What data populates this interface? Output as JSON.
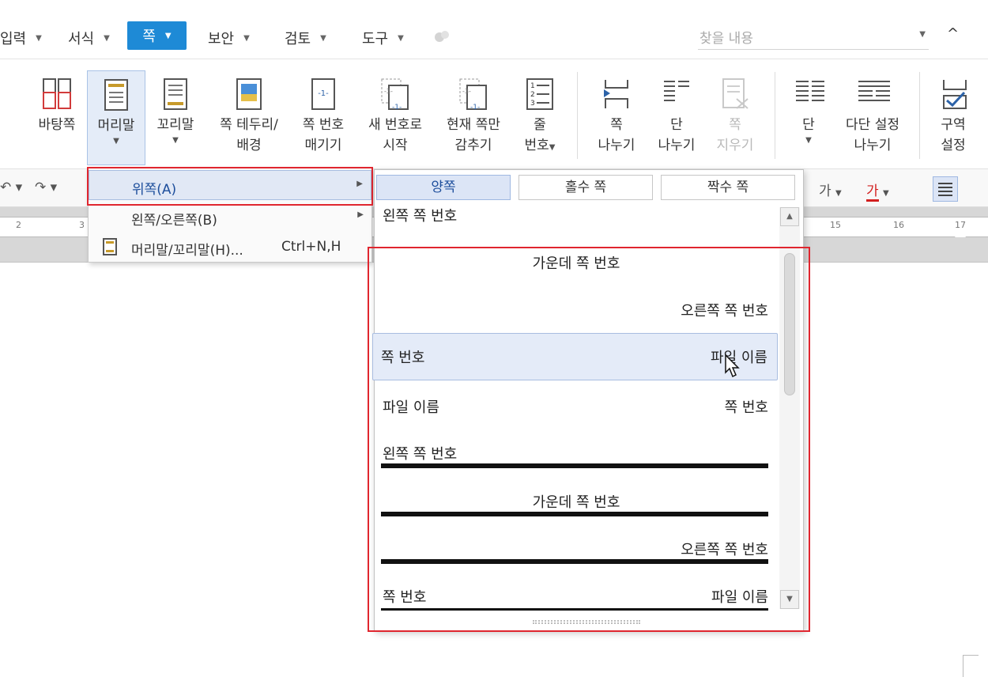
{
  "menubar": {
    "partial_left": "입력",
    "items": [
      {
        "label": "서식"
      },
      {
        "label": "쪽",
        "active": true
      },
      {
        "label": "보안"
      },
      {
        "label": "검토"
      },
      {
        "label": "도구"
      }
    ],
    "search_placeholder": "찾을 내용",
    "collapse_symbol": "^"
  },
  "ribbon": {
    "buttons": [
      {
        "id": "master-page",
        "label": "바탕쪽"
      },
      {
        "id": "header",
        "label": "머리말",
        "active": true,
        "dropdown": true
      },
      {
        "id": "footer",
        "label": "꼬리말",
        "dropdown": true
      },
      {
        "id": "page-border",
        "label1": "쪽 테두리/",
        "label2": "배경"
      },
      {
        "id": "page-number",
        "label1": "쪽 번호",
        "label2": "매기기"
      },
      {
        "id": "new-number",
        "label1": "새 번호로",
        "label2": "시작"
      },
      {
        "id": "hide-current",
        "label1": "현재 쪽만",
        "label2": "감추기"
      },
      {
        "id": "line-number",
        "label1": "줄",
        "label2": "번호"
      },
      {
        "id": "page-break",
        "label1": "쪽",
        "label2": "나누기"
      },
      {
        "id": "column-break",
        "label1": "단",
        "label2": "나누기"
      },
      {
        "id": "page-delete",
        "label1": "쪽",
        "label2": "지우기",
        "disabled": true
      },
      {
        "id": "columns",
        "label": "단",
        "dropdown": true
      },
      {
        "id": "multi-column",
        "label1": "다단 설정",
        "label2": "나누기"
      },
      {
        "id": "section",
        "label1": "구역",
        "label2": "설정"
      }
    ],
    "pagenum_glyph": "-1-",
    "pagenum_glyph_3": "-3-",
    "line_number_glyph": "1\n2\n3"
  },
  "toolbar2": {
    "char_glyph": "가",
    "color_char_glyph": "가"
  },
  "ruler": {
    "numbers": [
      "2",
      "3",
      "15",
      "16",
      "17"
    ]
  },
  "dropdown_menu": {
    "items": [
      {
        "label": "위쪽(A)",
        "submenu": true,
        "highlighted": true
      },
      {
        "label": "왼쪽/오른쪽(B)",
        "submenu": true
      },
      {
        "label": "머리말/꼬리말(H)...",
        "shortcut": "Ctrl+N,H"
      }
    ]
  },
  "gallery": {
    "tabs": [
      {
        "label": "양쪽",
        "selected": true
      },
      {
        "label": "홀수 쪽"
      },
      {
        "label": "짝수 쪽"
      }
    ],
    "items": [
      {
        "left": "왼쪽 쪽 번호"
      },
      {
        "center": "가운데 쪽 번호"
      },
      {
        "right": "오른쪽 쪽 번호"
      },
      {
        "left": "쪽 번호",
        "right": "파일 이름",
        "selected": true
      },
      {
        "left": "파일 이름",
        "right": "쪽 번호"
      },
      {
        "left": "왼쪽 쪽 번호",
        "rule": true
      },
      {
        "center": "가운데 쪽 번호",
        "rule": true
      },
      {
        "right": "오른쪽 쪽 번호",
        "rule": true
      },
      {
        "left": "쪽 번호",
        "right": "파일 이름",
        "rule": true
      }
    ]
  },
  "colors": {
    "accent_blue": "#1e8ad6",
    "highlight_red": "#e0262f",
    "selection_bg": "#e4ebf8"
  }
}
